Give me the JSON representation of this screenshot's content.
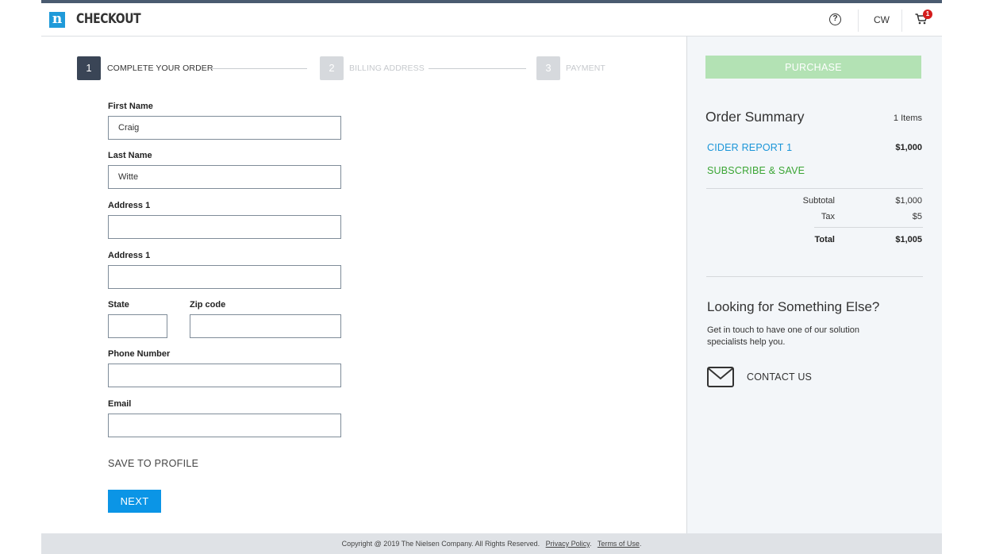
{
  "header": {
    "logo_glyph": "n",
    "title": "CHECKOUT",
    "help_glyph": "?",
    "user_initials": "CW",
    "cart_count": "1"
  },
  "steps": [
    {
      "number": "1",
      "label": "COMPLETE YOUR ORDER"
    },
    {
      "number": "2",
      "label": "BILLING ADDRESS"
    },
    {
      "number": "3",
      "label": "PAYMENT"
    }
  ],
  "form": {
    "first_name": {
      "label": "First Name",
      "value": "Craig"
    },
    "last_name": {
      "label": "Last Name",
      "value": "Witte"
    },
    "address1": {
      "label": "Address 1",
      "value": ""
    },
    "address2": {
      "label": "Address 1",
      "value": ""
    },
    "state": {
      "label": "State",
      "value": ""
    },
    "zip": {
      "label": "Zip code",
      "value": ""
    },
    "phone": {
      "label": "Phone Number",
      "value": ""
    },
    "email": {
      "label": "Email",
      "value": ""
    },
    "save_to_profile": "SAVE TO PROFILE",
    "next_label": "NEXT"
  },
  "summary": {
    "purchase_label": "PURCHASE",
    "title": "Order Summary",
    "item_count": "1 Items",
    "product_name": "CIDER REPORT 1",
    "product_price": "$1,000",
    "subscribe_label": "SUBSCRIBE & SAVE",
    "subtotal_label": "Subtotal",
    "subtotal_value": "$1,000",
    "tax_label": "Tax",
    "tax_value": "$5",
    "total_label": "Total",
    "total_value": "$1,005"
  },
  "help": {
    "title": "Looking for Something Else?",
    "text": "Get in touch to have one of our solution specialists help you.",
    "contact_label": "CONTACT US"
  },
  "footer": {
    "copyright": "Copyright @ 2019 The Nielsen Company. All Rights Reserved.",
    "privacy": "Privacy Policy",
    "terms": "Terms of Use"
  },
  "colors": {
    "brand_blue": "#1f9ad9",
    "next_button": "#0b95e6",
    "purchase_disabled": "#b3e2b4",
    "subscribe_green": "#3aa534",
    "cart_badge": "#d41c1c",
    "active_step": "#3a4556"
  },
  "icons": [
    "logo-icon",
    "help-icon",
    "cart-icon",
    "mail-icon"
  ]
}
